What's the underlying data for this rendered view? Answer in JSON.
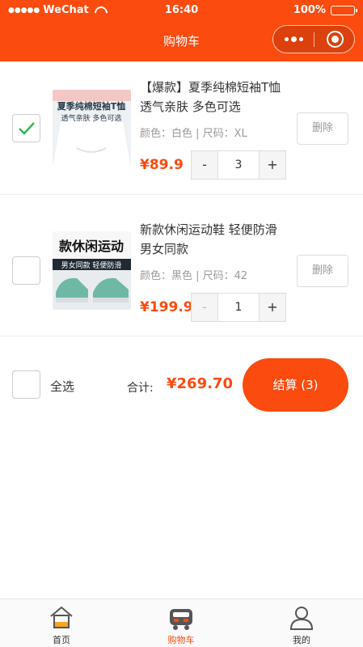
{
  "status_bar": {
    "signal_dots": "●●●●●",
    "carrier": "WeChat",
    "time": "16:40",
    "battery_text": "100%",
    "battery_level": 1.0
  },
  "nav": {
    "title": "购物车"
  },
  "cart": {
    "items": [
      {
        "title": "【爆款】夏季纯棉短袖T恤 透气亲肤 多色可选",
        "thumb_text_1": "夏季纯棉短袖T恤",
        "thumb_text_2": "透气亲肤 多色可选",
        "spec": "颜色：白色 | 尺码：XL",
        "price": "¥89.9",
        "minus": "-",
        "qty": "3",
        "plus": "+",
        "delete_label": "删除",
        "checked": true
      },
      {
        "title": "新款休闲运动鞋 轻便防滑 男女同款",
        "thumb_text_1": "款休闲运动",
        "thumb_text_2": "男女同款 轻便防滑",
        "spec": "颜色：黑色 | 尺码：42",
        "price": "¥199.9",
        "minus": "-",
        "qty": "1",
        "plus": "+",
        "delete_label": "删除",
        "checked": false
      }
    ]
  },
  "footer": {
    "select_all_label": "全选",
    "total_label": "合计:",
    "total_value": "¥269.70",
    "checkout_label": "结算 (3)"
  },
  "tabbar": {
    "tabs": [
      {
        "label": "首页",
        "icon": "home-icon",
        "active": false
      },
      {
        "label": "购物车",
        "icon": "cart-icon",
        "active": true
      },
      {
        "label": "我的",
        "icon": "user-icon",
        "active": false
      }
    ]
  },
  "colors": {
    "accent": "#fb4b0f",
    "check": "#2db84d",
    "muted": "#999999"
  }
}
